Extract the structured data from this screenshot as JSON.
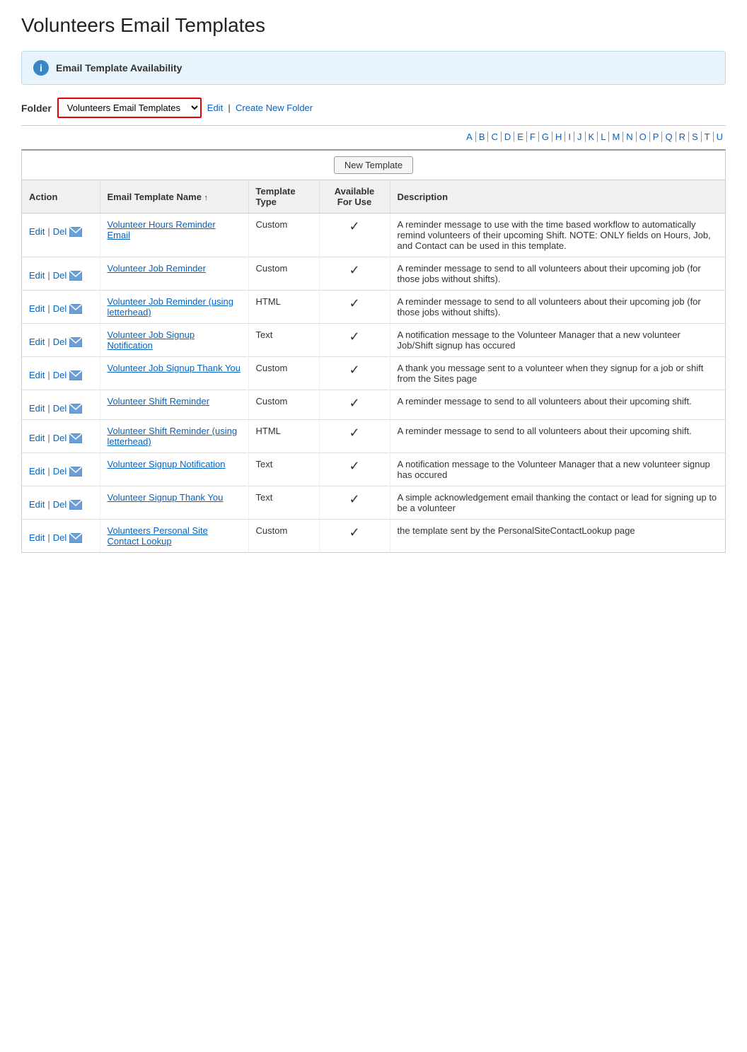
{
  "page": {
    "title": "Volunteers Email Templates"
  },
  "info_box": {
    "label": "Email Template Availability"
  },
  "folder": {
    "label": "Folder",
    "selected": "Volunteers Email Templates",
    "edit_label": "Edit",
    "create_label": "Create New Folder"
  },
  "alpha_nav": [
    "A",
    "B",
    "C",
    "D",
    "E",
    "F",
    "G",
    "H",
    "I",
    "J",
    "K",
    "L",
    "M",
    "N",
    "O",
    "P",
    "Q",
    "R",
    "S",
    "T",
    "U"
  ],
  "table": {
    "new_template_button": "New Template",
    "columns": {
      "action": "Action",
      "name": "Email Template Name",
      "type": "Template Type",
      "available": "Available For Use",
      "description": "Description"
    },
    "rows": [
      {
        "name": "Volunteer Hours Reminder Email",
        "type": "Custom",
        "available": true,
        "description": "A reminder message to use with the time based workflow to automatically remind volunteers of their upcoming Shift. NOTE: ONLY fields on Hours, Job, and Contact can be used in this template."
      },
      {
        "name": "Volunteer Job Reminder",
        "type": "Custom",
        "available": true,
        "description": "A reminder message to send to all volunteers about their upcoming job (for those jobs without shifts)."
      },
      {
        "name": "Volunteer Job Reminder (using letterhead)",
        "type": "HTML",
        "available": true,
        "description": "A reminder message to send to all volunteers about their upcoming job (for those jobs without shifts)."
      },
      {
        "name": "Volunteer Job Signup Notification",
        "type": "Text",
        "available": true,
        "description": "A notification message to the Volunteer Manager that a new volunteer Job/Shift signup has occured"
      },
      {
        "name": "Volunteer Job Signup Thank You",
        "type": "Custom",
        "available": true,
        "description": "A thank you message sent to a volunteer when they signup for a job or shift from the Sites page"
      },
      {
        "name": "Volunteer Shift Reminder",
        "type": "Custom",
        "available": true,
        "description": "A reminder message to send to all volunteers about their upcoming shift."
      },
      {
        "name": "Volunteer Shift Reminder (using letterhead)",
        "type": "HTML",
        "available": true,
        "description": "A reminder message to send to all volunteers about their upcoming shift."
      },
      {
        "name": "Volunteer Signup Notification",
        "type": "Text",
        "available": true,
        "description": "A notification message to the Volunteer Manager that a new volunteer signup has occured"
      },
      {
        "name": "Volunteer Signup Thank You",
        "type": "Text",
        "available": true,
        "description": "A simple acknowledgement email thanking the contact or lead for signing up to be a volunteer"
      },
      {
        "name": "Volunteers Personal Site Contact Lookup",
        "type": "Custom",
        "available": true,
        "description": "the template sent by the PersonalSiteContactLookup page"
      }
    ]
  }
}
